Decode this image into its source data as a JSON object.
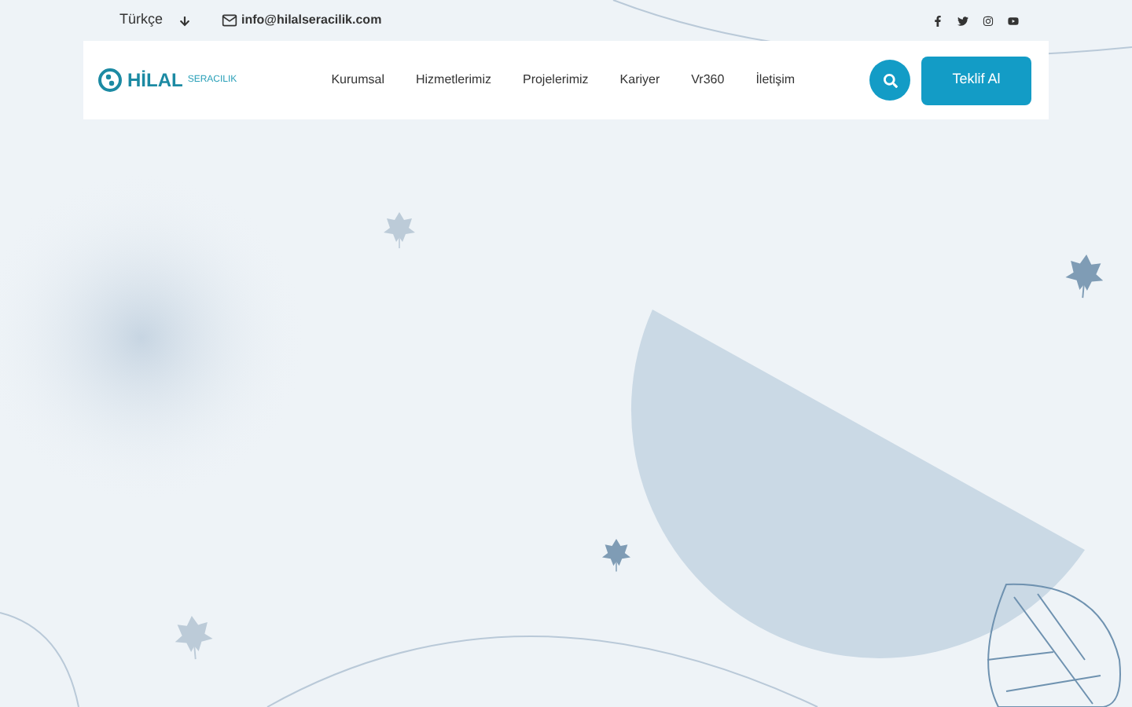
{
  "top_bar": {
    "language": "Türkçe",
    "email": "info@hilalseracilik.com"
  },
  "logo": {
    "name": "HİLAL",
    "tagline": "SERACILIK"
  },
  "nav": [
    "Kurumsal",
    "Hizmetlerimiz",
    "Projelerimiz",
    "Kariyer",
    "Vr360",
    "İletişim"
  ],
  "cta": "Teklif Al"
}
